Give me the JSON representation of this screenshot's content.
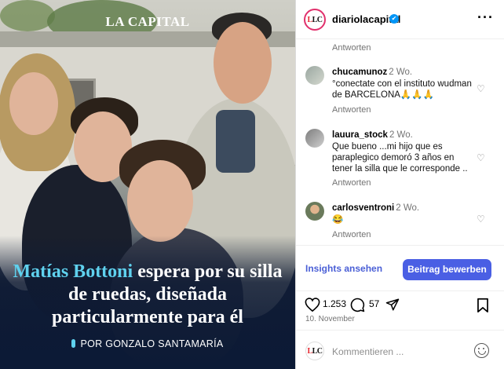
{
  "post_image": {
    "logo": "LA CAPITAL",
    "headline_highlight": "Matías Bottoni",
    "headline_rest": " espera por su silla de ruedas, diseñada particularmente para él",
    "byline": "POR GONZALO SANTAMARÍA"
  },
  "header": {
    "avatar_text": "LC",
    "username": "diariolacapital",
    "verified_icon": "✔",
    "more_icon": "···"
  },
  "comments": [
    {
      "username": "",
      "time": "",
      "text": "",
      "reply_label": "Antworten"
    },
    {
      "username": "chucamunoz",
      "time": "2 Wo.",
      "text": "°conectate con el instituto wudman de BARCELONA🙏🙏🙏",
      "reply_label": "Antworten"
    },
    {
      "username": "lauura_stock",
      "time": "2 Wo.",
      "text": "Que bueno ...mi hijo que es paraplegico demoró 3 años en tener la silla que le corresponde ..",
      "reply_label": "Antworten"
    },
    {
      "username": "carlosventroni",
      "time": "2 Wo.",
      "text": "😂",
      "reply_label": "Antworten"
    }
  ],
  "actions": {
    "insights_label": "Insights ansehen",
    "boost_label": "Beitrag bewerben"
  },
  "engagement": {
    "likes": "1.253",
    "comments": "57",
    "date": "10. November"
  },
  "compose": {
    "avatar_text": "LC",
    "placeholder": "Kommentieren ..."
  },
  "colors": {
    "highlight": "#5fd1ee",
    "button": "#4a5fe4",
    "link": "#4a5fd6",
    "verified": "#0095f6"
  }
}
